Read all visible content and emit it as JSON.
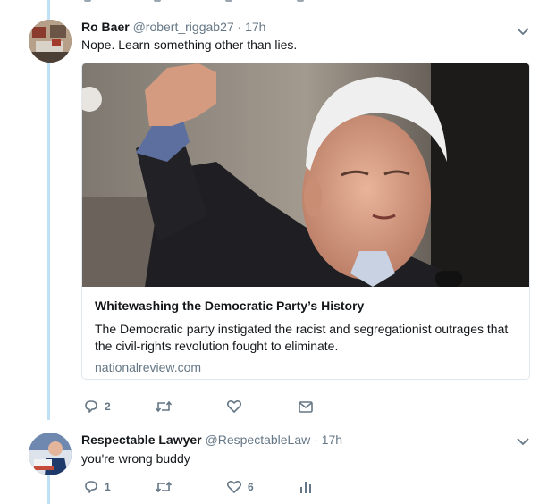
{
  "tweets": [
    {
      "name": "Ro Baer",
      "handle": "@robert_riggab27",
      "separator": "·",
      "time": "17h",
      "text": "Nope. Learn something other than lies.",
      "card": {
        "title": "Whitewashing the Democratic Party’s History",
        "desc_line1": "The Democratic party instigated the racist and segregationist outrages that",
        "desc_line2": "the civil-rights revolution fought to eliminate.",
        "domain": "nationalreview.com"
      },
      "actions": {
        "replies": "2",
        "retweets": "",
        "likes": "",
        "dm": ""
      }
    },
    {
      "name": "Respectable Lawyer",
      "handle": "@RespectableLaw",
      "separator": "·",
      "time": "17h",
      "text": "you're wrong buddy",
      "actions": {
        "replies": "1",
        "retweets": "",
        "likes": "6",
        "analytics": ""
      }
    }
  ],
  "colors": {
    "thread_line": "#bfe0f6",
    "secondary_text": "#657786",
    "icon": "#657786",
    "border": "#e1e8ed"
  }
}
